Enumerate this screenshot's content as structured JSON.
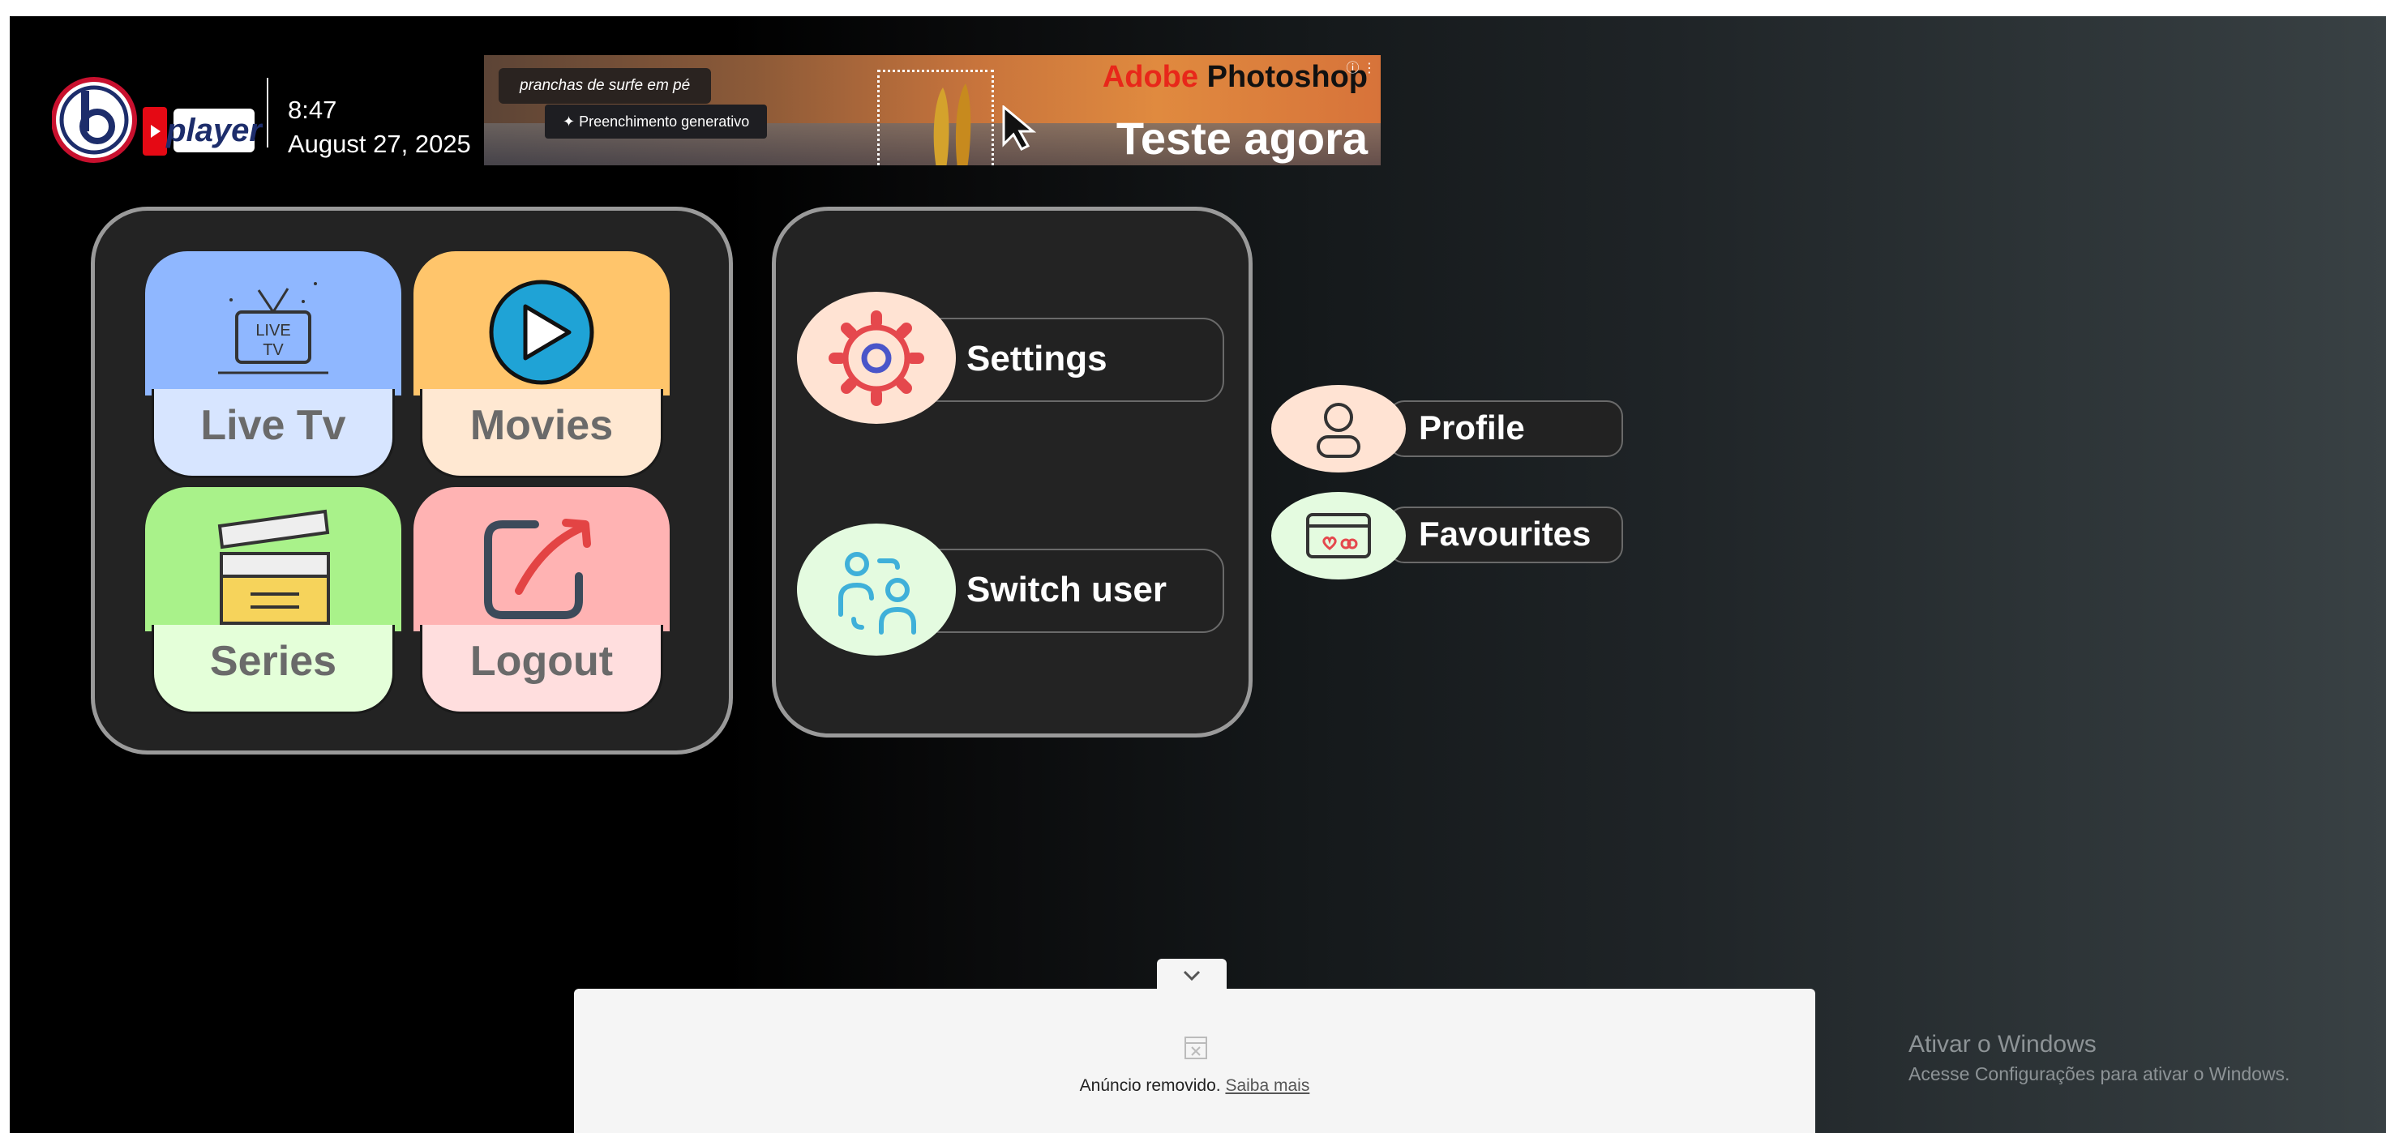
{
  "header": {
    "logo_text": "player",
    "time": "8:47",
    "date": "August 27, 2025"
  },
  "top_ad": {
    "chip_caption": "pranchas de surfe em pé",
    "chip_feature": "Preenchimento generativo",
    "brand_prefix": "Adobe",
    "brand_name": "Photoshop",
    "cta": "Teste agora",
    "info_icon": "ⓘ ⋮"
  },
  "main_menu": {
    "tiles": [
      {
        "label": "Live Tv",
        "icon": "live-tv-icon",
        "icon_text_1": "LIVE",
        "icon_text_2": "TV",
        "color": "#8fb7ff",
        "pale": "#d7e5ff"
      },
      {
        "label": "Movies",
        "icon": "play-icon",
        "color": "#ffc56b",
        "pale": "#ffe8d2"
      },
      {
        "label": "Series",
        "icon": "clapperboard-icon",
        "color": "#a9f28a",
        "pale": "#e4ffd9"
      },
      {
        "label": "Logout",
        "icon": "logout-icon",
        "color": "#ffb3b3",
        "pale": "#ffdede"
      }
    ]
  },
  "account_menu": {
    "settings_label": "Settings",
    "switch_user_label": "Switch user"
  },
  "quick_links": {
    "profile_label": "Profile",
    "favourites_label": "Favourites"
  },
  "bottom_ad": {
    "removed_text": "Anúncio removido.",
    "learn_more": "Saiba mais"
  },
  "watermark": {
    "line1": "Ativar o Windows",
    "line2": "Acesse Configurações para ativar o Windows."
  }
}
